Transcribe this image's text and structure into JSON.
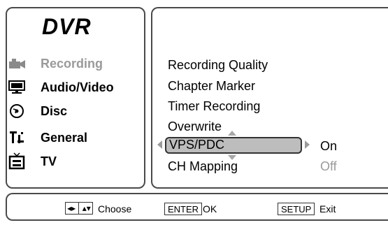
{
  "title": "DVR",
  "nav": [
    {
      "label": "Recording",
      "icon": "camcorder-icon",
      "active": true
    },
    {
      "label": "Audio/Video",
      "icon": "monitor-icon",
      "active": false
    },
    {
      "label": "Disc",
      "icon": "disc-icon",
      "active": false
    },
    {
      "label": "General",
      "icon": "general-settings-icon",
      "active": false
    },
    {
      "label": "TV",
      "icon": "tv-icon",
      "active": false
    }
  ],
  "menu": [
    {
      "label": "Recording Quality"
    },
    {
      "label": "Chapter Marker"
    },
    {
      "label": "Timer Recording"
    },
    {
      "label": "Overwrite"
    },
    {
      "label": "VPS/PDC",
      "value": "On",
      "selected": true
    },
    {
      "label": "CH Mapping",
      "value": "Off"
    }
  ],
  "footer": {
    "choose_label": "Choose",
    "enter_key": "ENTER",
    "enter_label": "OK",
    "setup_key": "SETUP",
    "setup_label": "Exit"
  },
  "colors": {
    "border": "#4a4a4a",
    "inactive": "#9a9a9a",
    "selection": "#bdbdbd"
  }
}
